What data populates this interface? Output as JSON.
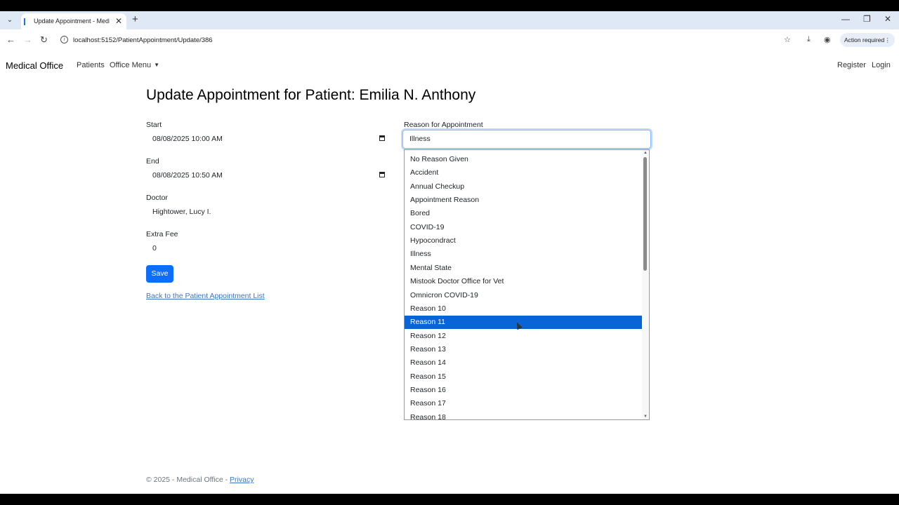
{
  "browser": {
    "tab_title": "Update Appointment - Medica",
    "url": "localhost:5152/PatientAppointment/Update/386",
    "action_chip": "Action required"
  },
  "navbar": {
    "brand": "Medical Office",
    "patients": "Patients",
    "office_menu": "Office Menu",
    "register": "Register",
    "login": "Login"
  },
  "page": {
    "title": "Update Appointment for Patient: Emilia N. Anthony"
  },
  "form": {
    "start_label": "Start",
    "start_value": "08/08/2025 10:00  AM",
    "end_label": "End",
    "end_value": "08/08/2025 10:50  AM",
    "doctor_label": "Doctor",
    "doctor_value": "Hightower, Lucy I.",
    "fee_label": "Extra Fee",
    "fee_value": "0",
    "save_label": "Save",
    "back_link": "Back to the Patient Appointment List",
    "reason_label": "Reason for Appointment",
    "reason_value": "Illness",
    "reason_options": [
      "No Reason Given",
      "Accident",
      "Annual Checkup",
      "Appointment Reason",
      "Bored",
      "COVID-19",
      "Hypocondract",
      "Illness",
      "Mental State",
      "Mistook Doctor Office for Vet",
      "Omnicron COVID-19",
      "Reason 10",
      "Reason 11",
      "Reason 12",
      "Reason 13",
      "Reason 14",
      "Reason 15",
      "Reason 16",
      "Reason 17",
      "Reason 18"
    ],
    "highlighted_option": "Reason 11"
  },
  "footer": {
    "text": "© 2025 - Medical Office - ",
    "privacy": "Privacy"
  },
  "colors": {
    "primary": "#0d6efd",
    "highlight": "#0a64d6"
  }
}
